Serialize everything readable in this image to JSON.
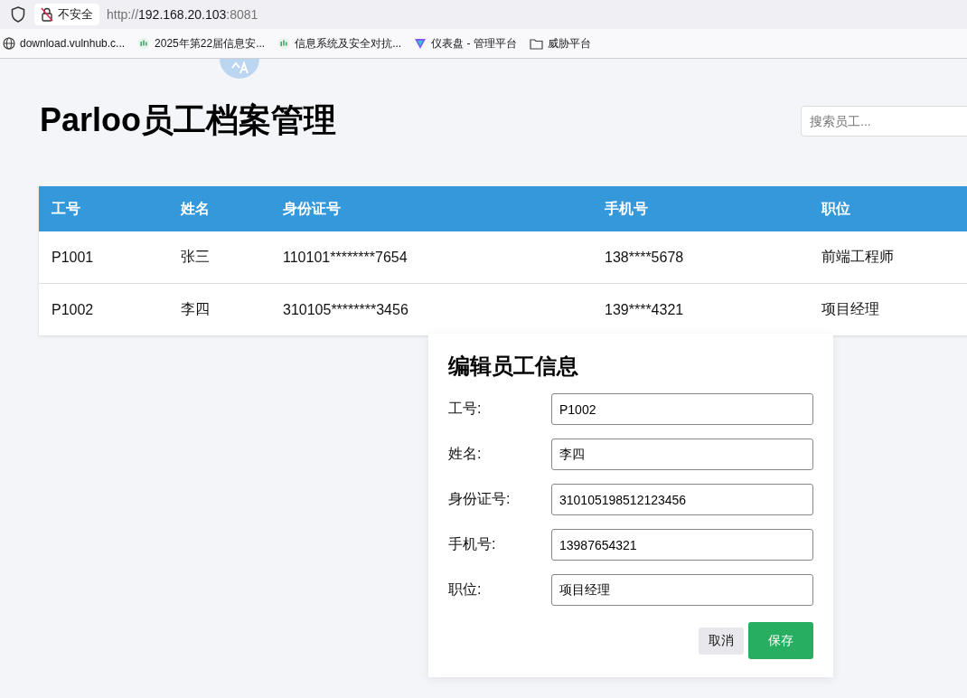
{
  "browser": {
    "security_label": "不安全",
    "url": [
      {
        "kind": "muted",
        "text": "http://"
      },
      {
        "kind": "host",
        "text": "192.168.20.103"
      },
      {
        "kind": "muted",
        "text": ":8081"
      }
    ],
    "bookmarks": [
      {
        "kind": "globe",
        "label": "download.vulnhub.c..."
      },
      {
        "kind": "chart",
        "label": "2025年第22届信息安..."
      },
      {
        "kind": "chart",
        "label": "信息系统及安全对抗..."
      },
      {
        "kind": "logo",
        "label": "仪表盘 - 管理平台"
      },
      {
        "kind": "folder",
        "label": "威胁平台"
      }
    ]
  },
  "page": {
    "title": "Parloo员工档案管理",
    "search": {
      "placeholder": "搜索员工..."
    }
  },
  "table": {
    "columns": [
      "工号",
      "姓名",
      "身份证号",
      "手机号",
      "职位"
    ],
    "rows": [
      [
        "P1001",
        "张三",
        "110101********7654",
        "138****5678",
        "前端工程师"
      ],
      [
        "P1002",
        "李四",
        "310105********3456",
        "139****4321",
        "项目经理"
      ]
    ]
  },
  "dialog": {
    "title": "编辑员工信息",
    "fields": [
      {
        "label": "工号:",
        "value": "P1002"
      },
      {
        "label": "姓名:",
        "value": "李四"
      },
      {
        "label": "身份证号:",
        "value": "310105198512123456"
      },
      {
        "label": "手机号:",
        "value": "13987654321"
      },
      {
        "label": "职位:",
        "value": "项目经理"
      }
    ],
    "buttons": [
      {
        "kind": "secondary",
        "label": "取消"
      },
      {
        "kind": "primary",
        "label": "保存"
      }
    ]
  }
}
